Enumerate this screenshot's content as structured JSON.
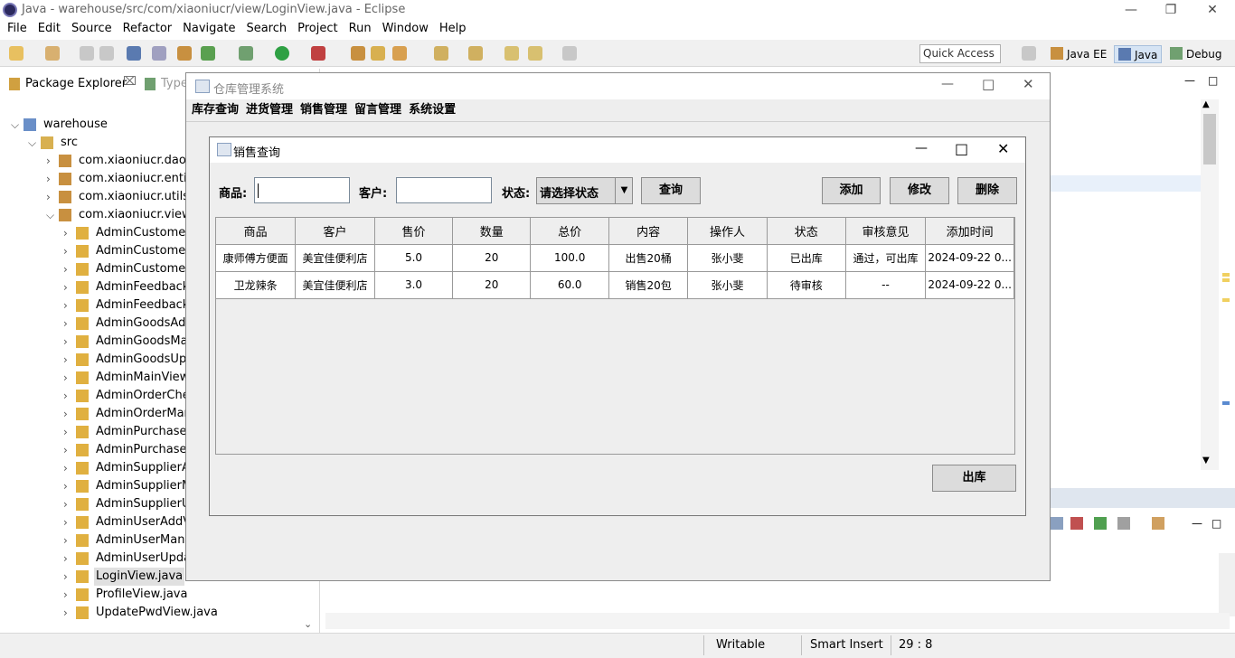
{
  "eclipse": {
    "title": "Java - warehouse/src/com/xiaoniucr/view/LoginView.java - Eclipse",
    "menu": [
      "File",
      "Edit",
      "Source",
      "Refactor",
      "Navigate",
      "Search",
      "Project",
      "Run",
      "Window",
      "Help"
    ],
    "quick_access": "Quick Access",
    "perspectives": [
      "Java EE",
      "Java",
      "Debug"
    ]
  },
  "package_explorer": {
    "tab_label": "Package Explorer",
    "second_tab_label": "Type",
    "project": "warehouse",
    "src": "src",
    "packages": [
      "com.xiaoniucr.dao",
      "com.xiaoniucr.entity",
      "com.xiaoniucr.utils",
      "com.xiaoniucr.view"
    ],
    "files": [
      "AdminCustomerA",
      "AdminCustomerM",
      "AdminCustomerU",
      "AdminFeedbackM",
      "AdminFeedbackR",
      "AdminGoodsAdd",
      "AdminGoodsMar",
      "AdminGoodsUpd",
      "AdminMainView.j",
      "AdminOrderChec",
      "AdminOrderMana",
      "AdminPurchaseCl",
      "AdminPurchaseM",
      "AdminSupplierAd",
      "AdminSupplierMa",
      "AdminSupplierUp",
      "AdminUserAddVi",
      "AdminUserManag",
      "AdminUserUpdat",
      "LoginView.java",
      "ProfileView.java",
      "UpdatePwdView.java"
    ],
    "selected_file": "LoginView.java"
  },
  "statusbar": {
    "writable": "Writable",
    "insert_mode": "Smart Insert",
    "position": "29 : 8"
  },
  "app": {
    "title": "仓库管理系统",
    "menu": [
      "库存查询",
      "进货管理",
      "销售管理",
      "留言管理",
      "系统设置"
    ]
  },
  "dialog": {
    "title": "销售查询",
    "goods_label": "商品:",
    "goods_value": "",
    "customer_label": "客户:",
    "customer_value": "",
    "status_label": "状态:",
    "status_selected": "请选择状态",
    "query_btn": "查询",
    "add_btn": "添加",
    "edit_btn": "修改",
    "delete_btn": "删除",
    "outbound_btn": "出库",
    "table": {
      "columns": [
        "商品",
        "客户",
        "售价",
        "数量",
        "总价",
        "内容",
        "操作人",
        "状态",
        "审核意见",
        "添加时间"
      ],
      "rows": [
        [
          "康师傅方便面",
          "美宜佳便利店",
          "5.0",
          "20",
          "100.0",
          "出售20桶",
          "张小斐",
          "已出库",
          "通过，可出库",
          "2024-09-22 0..."
        ],
        [
          "卫龙辣条",
          "美宜佳便利店",
          "3.0",
          "20",
          "60.0",
          "销售20包",
          "张小斐",
          "待审核",
          "--",
          "2024-09-22 0..."
        ]
      ]
    }
  }
}
